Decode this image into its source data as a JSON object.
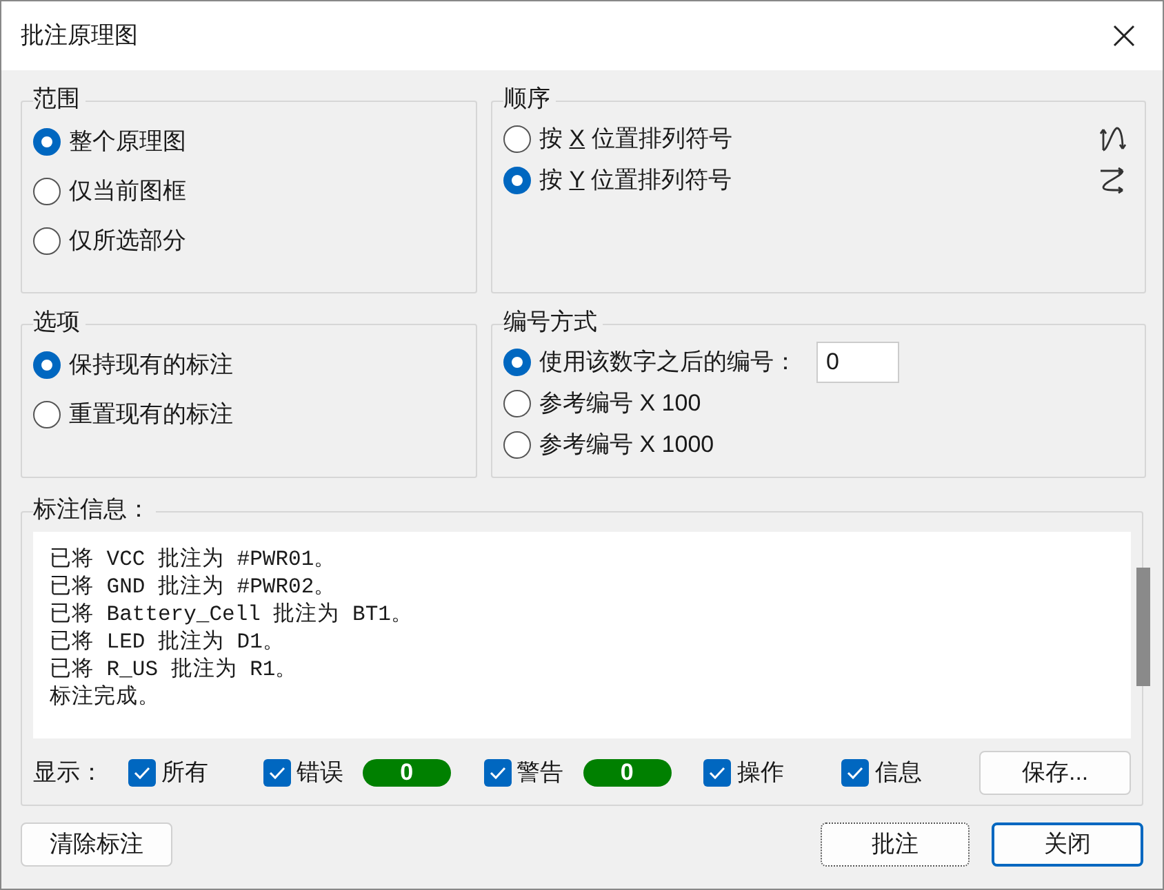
{
  "window": {
    "title": "批注原理图"
  },
  "scope": {
    "title": "范围",
    "options": [
      {
        "label": "整个原理图",
        "selected": true
      },
      {
        "label": "仅当前图框",
        "selected": false
      },
      {
        "label": "仅所选部分",
        "selected": false
      }
    ]
  },
  "order": {
    "title": "顺序",
    "options": [
      {
        "prefix": "按 ",
        "key": "X",
        "suffix": " 位置排列符号",
        "selected": false,
        "kind": "x"
      },
      {
        "prefix": "按 ",
        "key": "Y",
        "suffix": " 位置排列符号",
        "selected": true,
        "kind": "y"
      }
    ]
  },
  "options": {
    "title": "选项",
    "options": [
      {
        "label": "保持现有的标注",
        "selected": true
      },
      {
        "label": "重置现有的标注",
        "selected": false
      }
    ]
  },
  "numbering": {
    "title": "编号方式",
    "options": [
      {
        "label": "使用该数字之后的编号：",
        "selected": true,
        "value": "0"
      },
      {
        "label": "参考编号 X 100",
        "selected": false
      },
      {
        "label": "参考编号 X 1000",
        "selected": false
      }
    ]
  },
  "messages": {
    "title": "标注信息：",
    "lines": [
      "已将 VCC 批注为 #PWR01。",
      "已将 GND 批注为 #PWR02。",
      "已将 Battery_Cell 批注为 BT1。",
      "已将 LED 批注为 D1。",
      "已将 R_US 批注为 R1。",
      "标注完成。"
    ]
  },
  "filters": {
    "label": "显示：",
    "items": [
      {
        "label": "所有",
        "checked": true
      },
      {
        "label": "错误",
        "checked": true,
        "count": "0"
      },
      {
        "label": "警告",
        "checked": true,
        "count": "0"
      },
      {
        "label": "操作",
        "checked": true
      },
      {
        "label": "信息",
        "checked": true
      }
    ],
    "save_button": "保存..."
  },
  "buttons": {
    "clear": "清除标注",
    "annotate": "批注",
    "close": "关闭"
  }
}
